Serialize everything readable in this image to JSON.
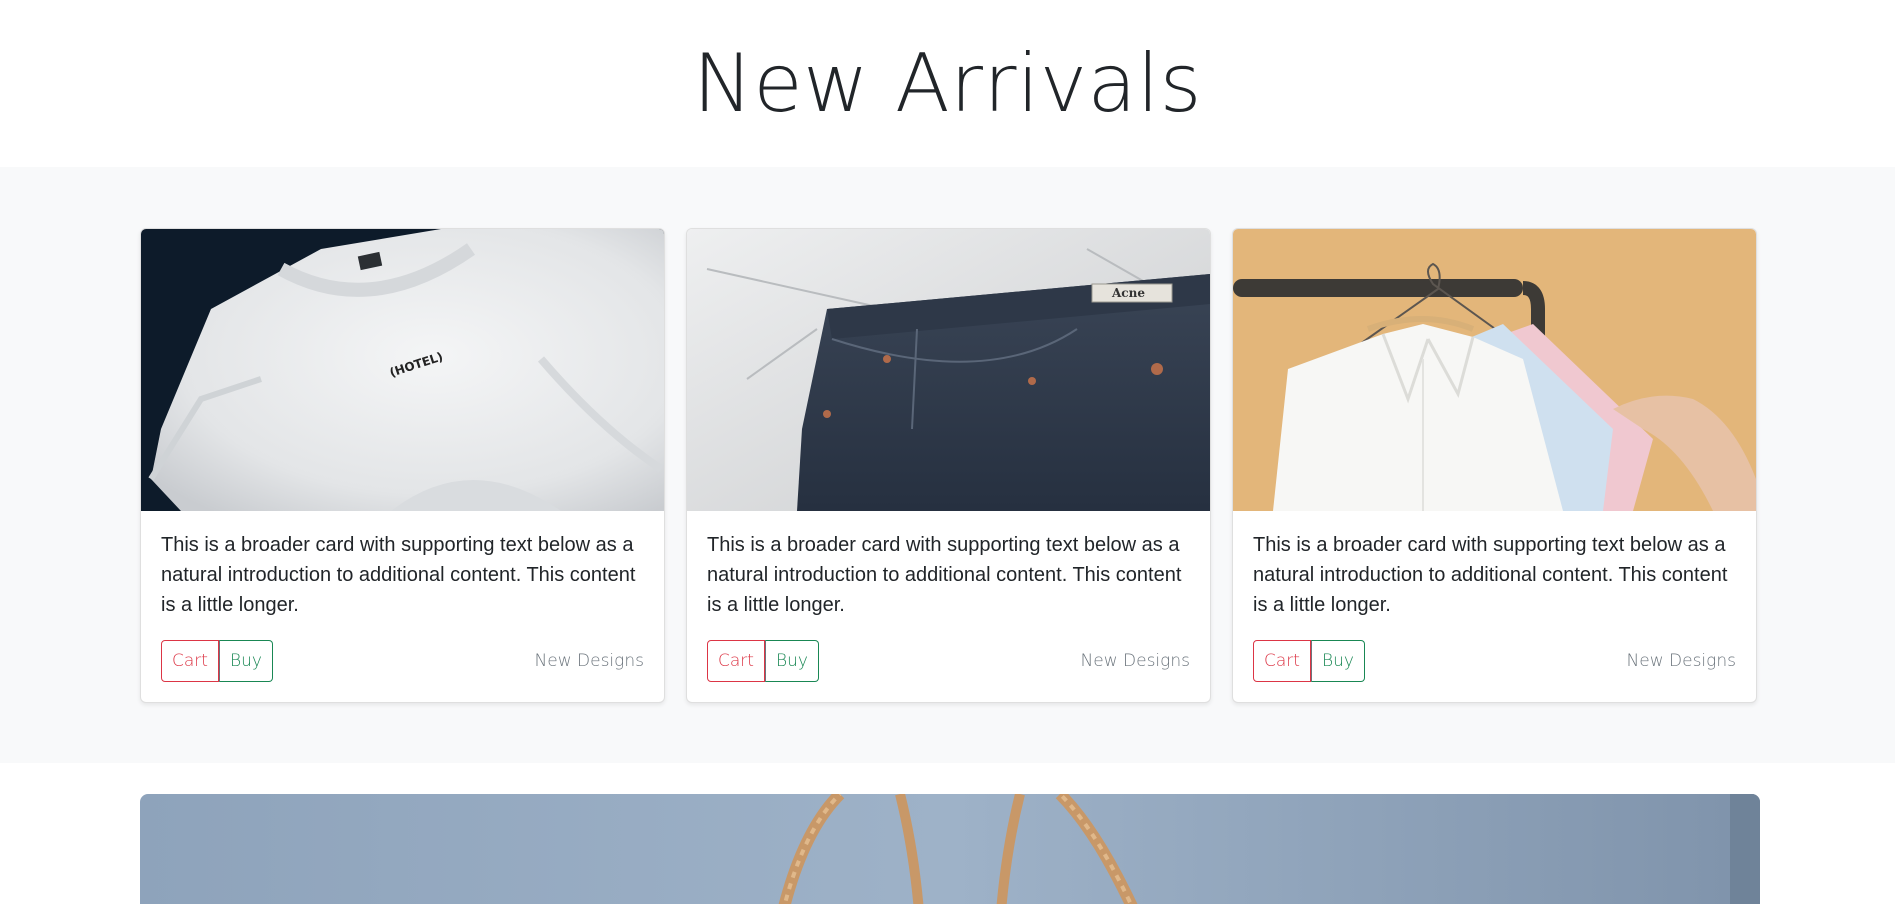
{
  "header": {
    "title": "New Arrivals"
  },
  "cards": [
    {
      "image_icon": "white-tshirt-photo",
      "image_label": "(HOTEL)",
      "text": "This is a broader card with supporting text below as a natural introduction to additional content. This content is a little longer.",
      "cart_label": "Cart",
      "buy_label": "Buy",
      "meta": "New Designs"
    },
    {
      "image_icon": "denim-jeans-photo",
      "image_label": "Acne",
      "text": "This is a broader card with supporting text below as a natural introduction to additional content. This content is a little longer.",
      "cart_label": "Cart",
      "buy_label": "Buy",
      "meta": "New Designs"
    },
    {
      "image_icon": "shirts-on-rack-photo",
      "text": "This is a broader card with supporting text below as a natural introduction to additional content. This content is a little longer.",
      "cart_label": "Cart",
      "buy_label": "Buy",
      "meta": "New Designs"
    }
  ],
  "banner": {
    "image_icon": "wicker-basket-photo"
  },
  "colors": {
    "band_background": "#f8f9fa",
    "cart_accent": "#dc3545",
    "buy_accent": "#198754",
    "muted_text": "#6c757d"
  }
}
